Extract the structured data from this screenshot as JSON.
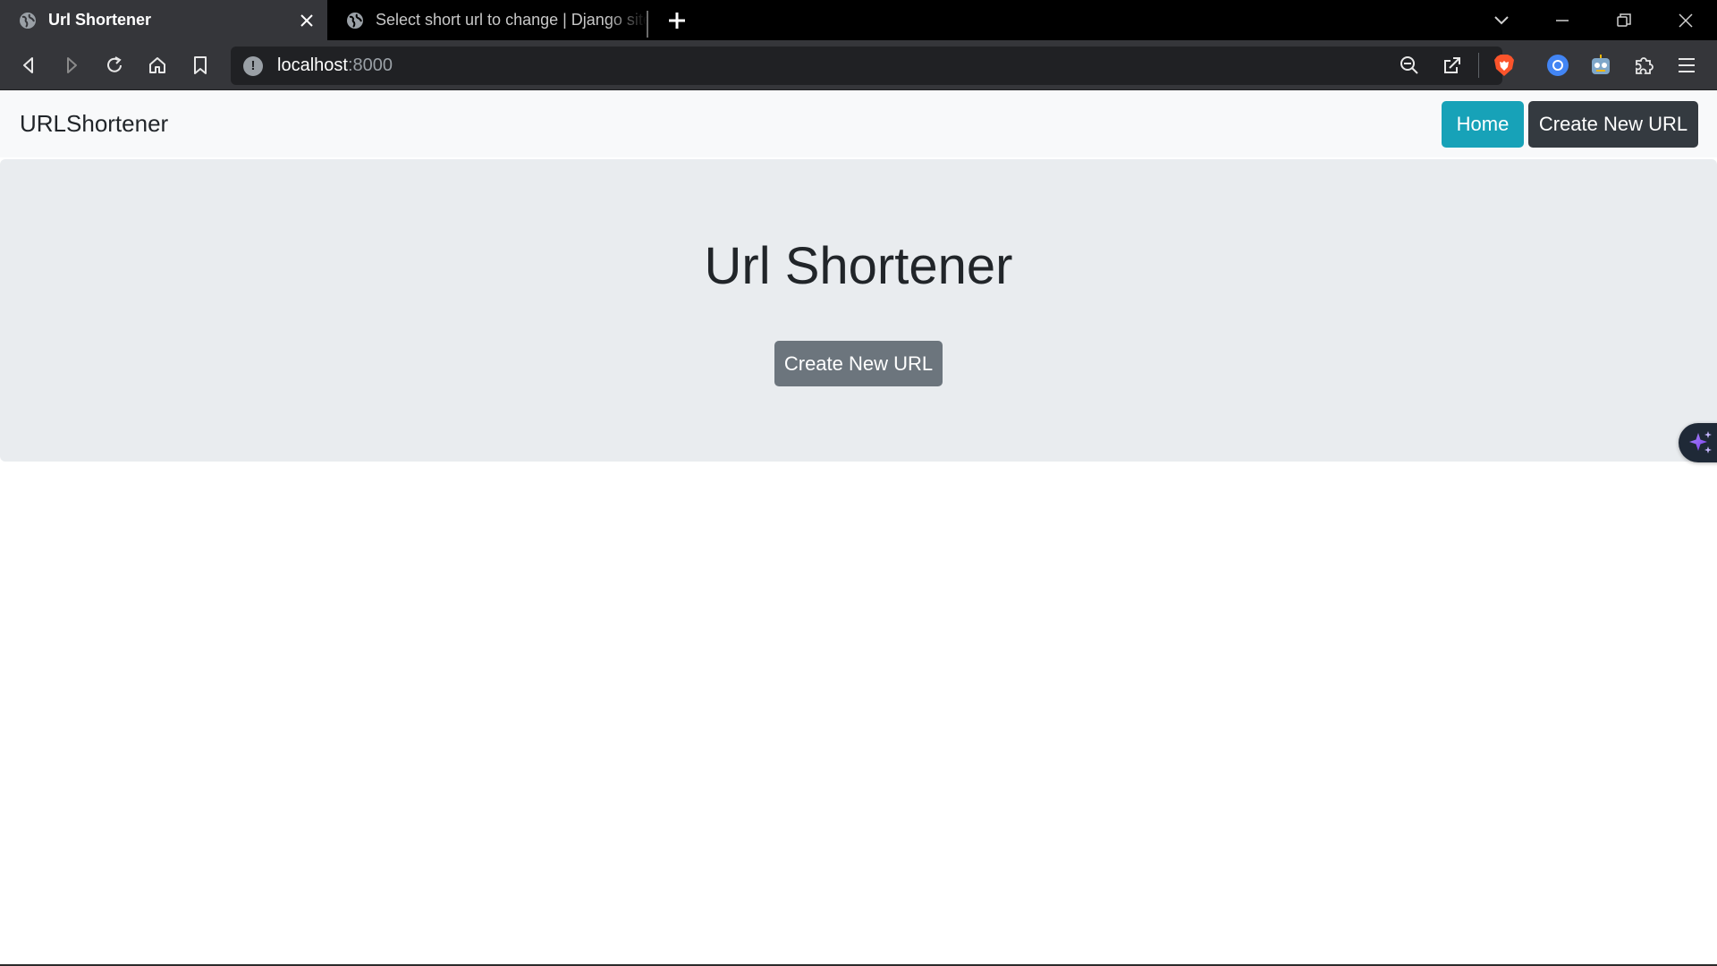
{
  "browser": {
    "tabs": [
      {
        "title": "Url Shortener",
        "active": true,
        "icon": "globe-icon"
      },
      {
        "title": "Select short url to change | Django site admin",
        "active": false,
        "icon": "globe-icon"
      }
    ],
    "address": {
      "host": "localhost",
      "port": ":8000"
    },
    "colors": {
      "tabbar": "#000000",
      "toolbar": "#35363a",
      "urlbar": "#202124"
    }
  },
  "navbar": {
    "brand": "URLShortener",
    "home_label": "Home",
    "create_label": "Create New URL",
    "colors": {
      "home": "#17a2b8",
      "create": "#343a40"
    }
  },
  "jumbotron": {
    "title": "Url Shortener",
    "button_label": "Create New URL",
    "button_color": "#6c757d"
  }
}
